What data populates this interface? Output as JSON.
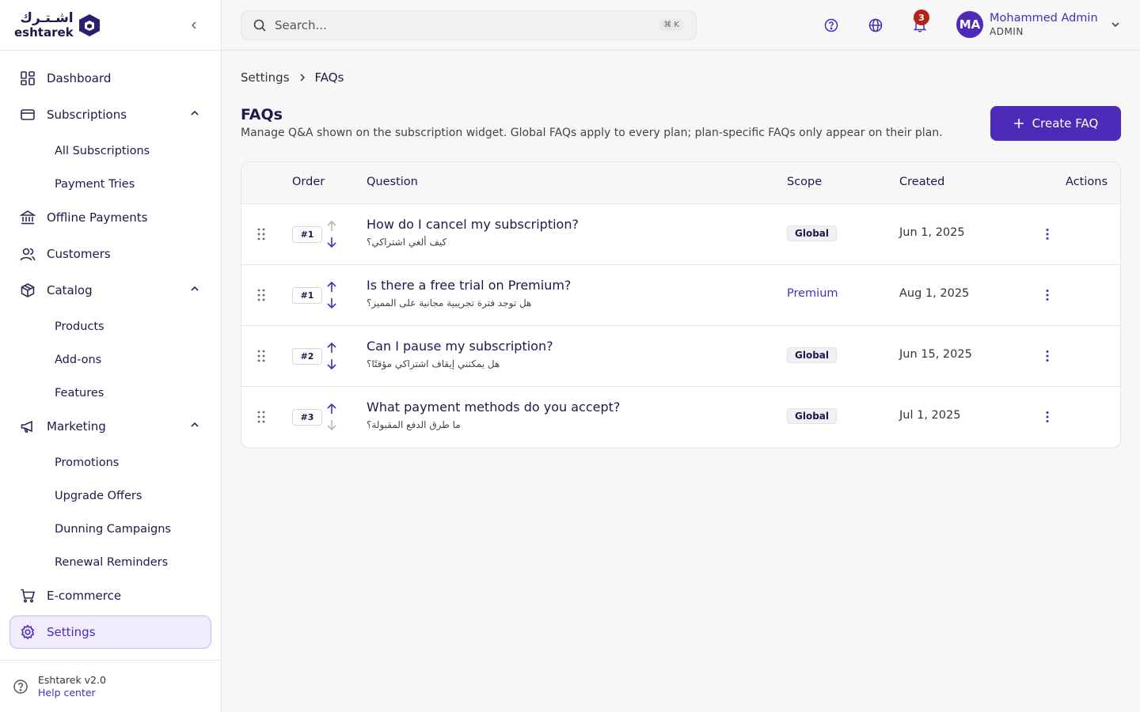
{
  "brand": {
    "name_ar": "اشـتـرك",
    "name_en": "eshtarek"
  },
  "sidebar": {
    "items": [
      {
        "label": "Dashboard",
        "icon": "dashboard-icon"
      },
      {
        "label": "Subscriptions",
        "icon": "card-icon",
        "children": [
          "All Subscriptions",
          "Payment Tries"
        ]
      },
      {
        "label": "Offline Payments",
        "icon": "bank-icon"
      },
      {
        "label": "Customers",
        "icon": "users-icon"
      },
      {
        "label": "Catalog",
        "icon": "box-icon",
        "children": [
          "Products",
          "Add-ons",
          "Features"
        ]
      },
      {
        "label": "Marketing",
        "icon": "megaphone-icon",
        "children": [
          "Promotions",
          "Upgrade Offers",
          "Dunning Campaigns",
          "Renewal Reminders"
        ]
      },
      {
        "label": "E-commerce",
        "icon": "cart-icon"
      },
      {
        "label": "Settings",
        "icon": "gear-icon",
        "active": true
      }
    ],
    "footer": {
      "version": "Eshtarek v2.0",
      "help": "Help center"
    }
  },
  "topbar": {
    "search_placeholder": "Search...",
    "shortcut": "⌘ K",
    "notifications_count": "3",
    "user": {
      "initials": "MA",
      "name": "Mohammed Admin",
      "role": "ADMIN"
    }
  },
  "breadcrumb": {
    "parent": "Settings",
    "current": "FAQs"
  },
  "page": {
    "title": "FAQs",
    "description": "Manage Q&A shown on the subscription widget. Global FAQs apply to every plan; plan-specific FAQs only appear on their plan.",
    "create_label": "Create FAQ"
  },
  "table": {
    "columns": {
      "order": "Order",
      "question": "Question",
      "scope": "Scope",
      "created": "Created",
      "actions": "Actions"
    },
    "rows": [
      {
        "order": "#1",
        "question": "How do I cancel my subscription?",
        "question_ar": "كيف ألغي اشتراكي؟",
        "scope": "Global",
        "scope_type": "global",
        "created": "Jun 1, 2025"
      },
      {
        "order": "#1",
        "question": "Is there a free trial on Premium?",
        "question_ar": "هل توجد فترة تجريبية مجانية على المميز؟",
        "scope": "Premium",
        "scope_type": "plan",
        "created": "Aug 1, 2025"
      },
      {
        "order": "#2",
        "question": "Can I pause my subscription?",
        "question_ar": "هل يمكنني إيقاف اشتراكي مؤقتًا؟",
        "scope": "Global",
        "scope_type": "global",
        "created": "Jun 15, 2025"
      },
      {
        "order": "#3",
        "question": "What payment methods do you accept?",
        "question_ar": "ما طرق الدفع المقبولة؟",
        "scope": "Global",
        "scope_type": "global",
        "created": "Jul 1, 2025"
      }
    ]
  },
  "colors": {
    "accent": "#4d2ab8",
    "badge": "#b42318",
    "active_bg": "#f1ecfb"
  }
}
